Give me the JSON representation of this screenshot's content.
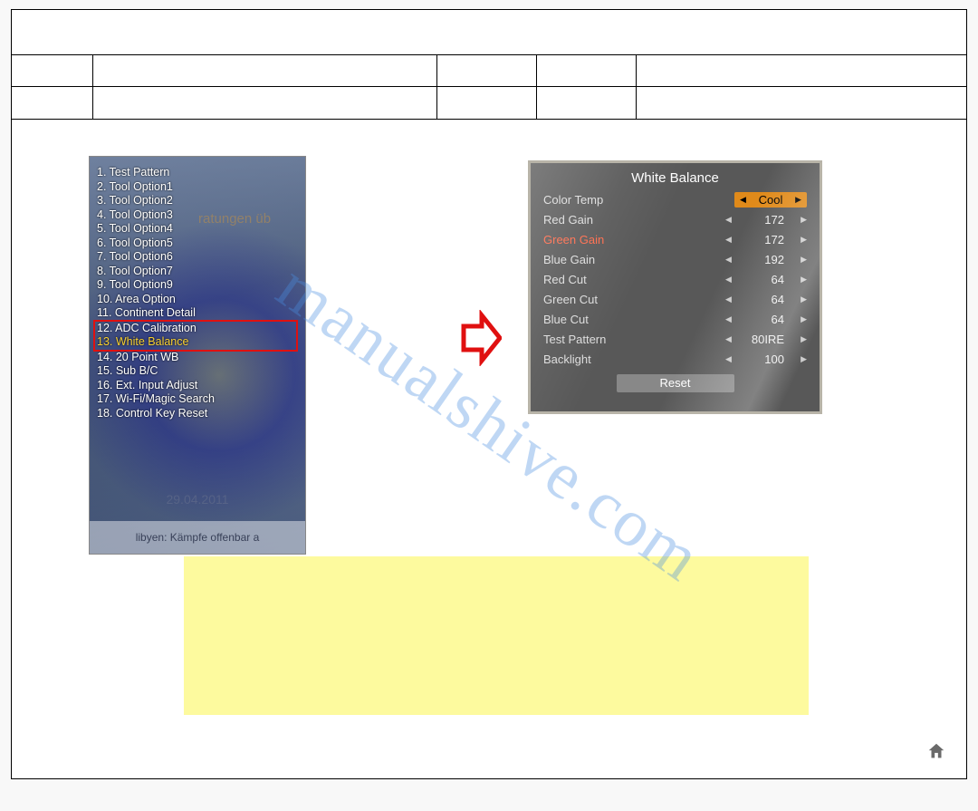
{
  "watermark": "manualshive.com",
  "leftMenu": {
    "bgText": "ratungen üb",
    "items": [
      {
        "label": "1. Test Pattern"
      },
      {
        "label": "2. Tool Option1"
      },
      {
        "label": "3. Tool Option2"
      },
      {
        "label": "4. Tool Option3"
      },
      {
        "label": "5. Tool Option4"
      },
      {
        "label": "6. Tool Option5"
      },
      {
        "label": "7. Tool Option6"
      },
      {
        "label": "8. Tool Option7"
      },
      {
        "label": "9. Tool Option9"
      },
      {
        "label": "10. Area Option"
      },
      {
        "label": "11. Continent Detail"
      },
      {
        "label": "12. ADC Calibration",
        "boxed": true
      },
      {
        "label": "13. White Balance",
        "boxed": true,
        "selected": true
      },
      {
        "label": "14. 20 Point WB"
      },
      {
        "label": "15. Sub B/C"
      },
      {
        "label": "16. Ext. Input Adjust"
      },
      {
        "label": "17. Wi-Fi/Magic Search"
      },
      {
        "label": "18. Control Key Reset"
      }
    ],
    "date": "29.04.2011",
    "news": "libyen: Kämpfe offenbar a"
  },
  "whiteBalance": {
    "title": "White Balance",
    "rows": [
      {
        "label": "Color Temp",
        "value": "Cool",
        "highlight": true
      },
      {
        "label": "Red Gain",
        "value": "172"
      },
      {
        "label": "Green Gain",
        "value": "172",
        "labelClass": "gg"
      },
      {
        "label": "Blue Gain",
        "value": "192"
      },
      {
        "label": "Red Cut",
        "value": "64"
      },
      {
        "label": "Green Cut",
        "value": "64"
      },
      {
        "label": "Blue Cut",
        "value": "64"
      },
      {
        "label": "Test Pattern",
        "value": "80IRE"
      },
      {
        "label": "Backlight",
        "value": "100"
      }
    ],
    "reset": "Reset"
  }
}
